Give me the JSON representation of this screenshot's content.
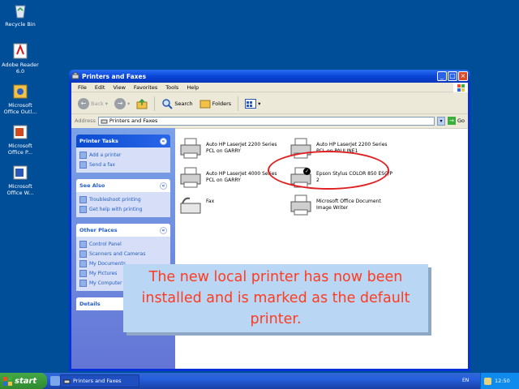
{
  "desktop": {
    "icons": [
      {
        "label": "Recycle Bin",
        "icon": "recycle-bin-icon"
      },
      {
        "label": "Adobe Reader\n6.0",
        "icon": "adobe-reader-icon"
      },
      {
        "label": "Microsoft\nOffice Outl...",
        "icon": "outlook-icon"
      },
      {
        "label": "Microsoft\nOffice P...",
        "icon": "powerpoint-icon"
      },
      {
        "label": "Microsoft\nOffice W...",
        "icon": "word-icon"
      }
    ]
  },
  "window": {
    "title": "Printers and Faxes",
    "menu": [
      "File",
      "Edit",
      "View",
      "Favorites",
      "Tools",
      "Help"
    ],
    "toolbar": {
      "back": "Back",
      "search": "Search",
      "folders": "Folders"
    },
    "address": {
      "label": "Address",
      "value": "Printers and Faxes",
      "go": "Go"
    }
  },
  "taskpane": {
    "printer_tasks": {
      "title": "Printer Tasks",
      "links": [
        "Add a printer",
        "Send a fax"
      ]
    },
    "see_also": {
      "title": "See Also",
      "links": [
        "Troubleshoot printing",
        "Get help with printing"
      ]
    },
    "other_places": {
      "title": "Other Places",
      "links": [
        "Control Panel",
        "Scanners and Cameras",
        "My Documents",
        "My Pictures",
        "My Computer"
      ]
    },
    "details": {
      "title": "Details"
    }
  },
  "printers": [
    {
      "line1": "Auto HP LaserJet 2200 Series",
      "line2": "PCL on GARRY",
      "default": false
    },
    {
      "line1": "Auto HP LaserJet 2200 Series",
      "line2": "PCL on PAULINE1",
      "default": false
    },
    {
      "line1": "Auto HP LaserJet 4000 Series",
      "line2": "PCL on GARRY",
      "default": false
    },
    {
      "line1": "Epson Stylus COLOR 850 ESC/P",
      "line2": "2",
      "default": true
    },
    {
      "line1": "Fax",
      "line2": "",
      "default": false
    },
    {
      "line1": "Microsoft Office Document",
      "line2": "Image Writer",
      "default": false
    }
  ],
  "callout": {
    "text": "The new local printer has now been installed and is marked as the default printer."
  },
  "taskbar": {
    "start": "start",
    "task": "Printers and Faxes",
    "lang": "EN",
    "clock": "12:50"
  },
  "colors": {
    "highlight": "#e02020",
    "callout_text": "#ff3b1f",
    "callout_bg": "#b9d7f5"
  }
}
